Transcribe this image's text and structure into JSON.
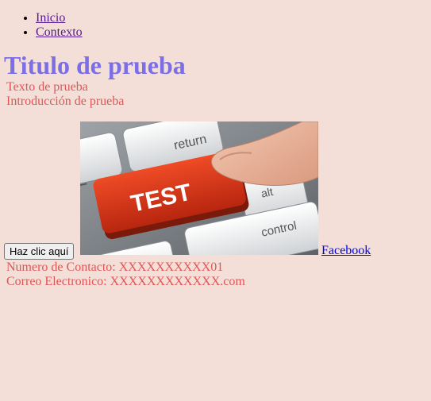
{
  "nav": {
    "items": [
      {
        "label": "Inicio"
      },
      {
        "label": "Contexto"
      }
    ]
  },
  "heading": "Titulo de prueba",
  "texts": {
    "sample": "Texto de prueba",
    "intro": "Introducción de prueba",
    "contact_number": "Numero de Contacto: XXXXXXXXXX01",
    "email": "Correo Electronico: XXXXXXXXXXXX.com"
  },
  "button": {
    "label": "Haz clic aquí"
  },
  "image": {
    "keycaps": [
      "TEST",
      "return",
      "alt",
      "control"
    ],
    "colors": {
      "key_red": "#d93216",
      "key_white": "#f2f2f2",
      "board": "#7f8489"
    }
  },
  "link": {
    "label": "Facebook"
  },
  "colors": {
    "background": "#f3dfd8",
    "heading": "#7b6ee6",
    "text": "#e05555",
    "visited_link": "#551a8b",
    "link": "#0000ee"
  }
}
